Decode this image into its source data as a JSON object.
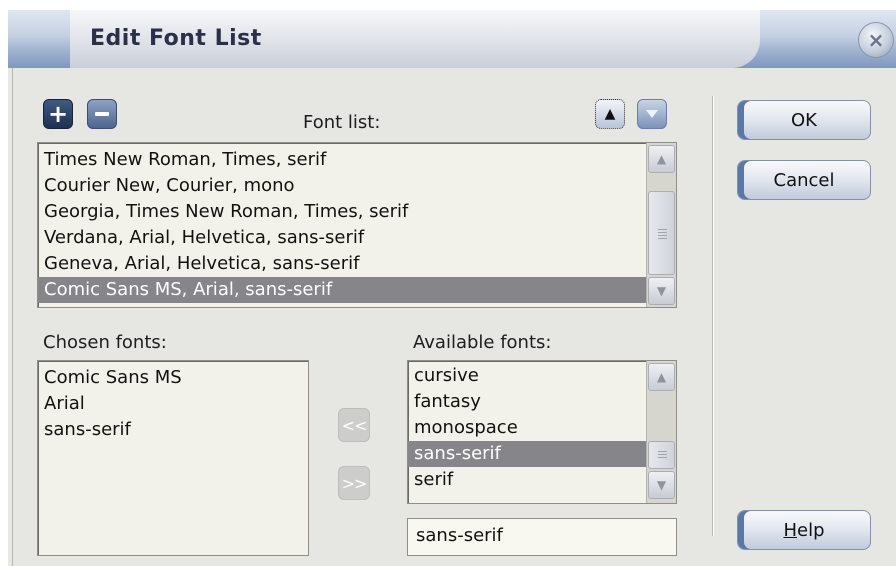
{
  "window": {
    "title": "Edit Font List"
  },
  "toolbar": {
    "add_label": "+",
    "up_label": "▲"
  },
  "font_list": {
    "label": "Font list:",
    "items": [
      "Times New Roman, Times, serif",
      "Courier New, Courier, mono",
      "Georgia, Times New Roman, Times, serif",
      "Verdana, Arial, Helvetica, sans-serif",
      "Geneva, Arial, Helvetica, sans-serif",
      "Comic Sans MS, Arial, sans-serif"
    ],
    "selected_index": 5
  },
  "chosen_fonts": {
    "label": "Chosen fonts:",
    "items": [
      "Comic Sans MS",
      "Arial",
      "sans-serif"
    ]
  },
  "available_fonts": {
    "label": "Available fonts:",
    "items": [
      "cursive",
      "fantasy",
      "monospace",
      "sans-serif",
      "serif"
    ],
    "selected_index": 3,
    "input_value": "sans-serif"
  },
  "transfer": {
    "add_label": "<<",
    "remove_label": ">>"
  },
  "buttons": {
    "ok": "OK",
    "cancel": "Cancel",
    "help_mnemonic": "H",
    "help_rest": "elp"
  }
}
